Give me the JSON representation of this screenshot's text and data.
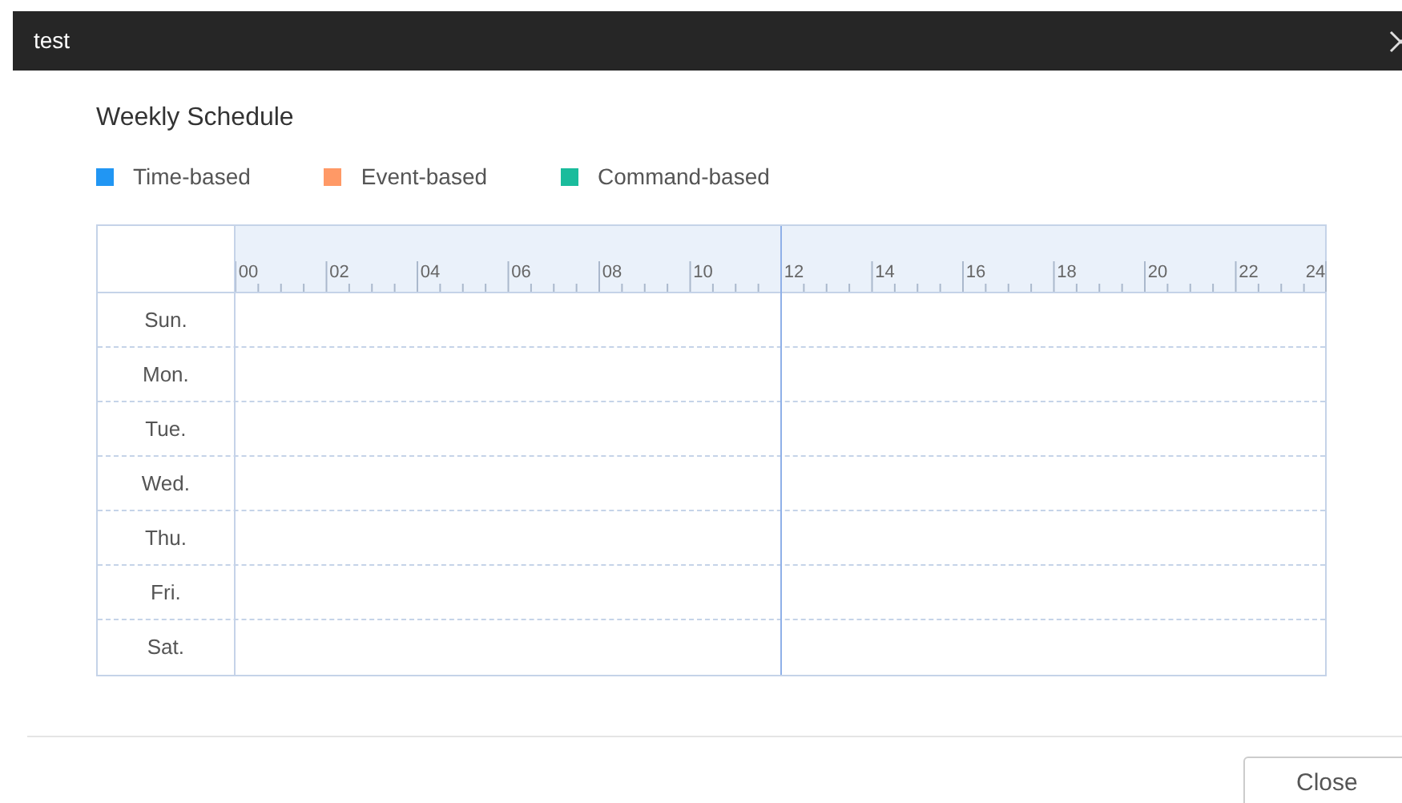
{
  "window": {
    "title": "test"
  },
  "heading": "Weekly Schedule",
  "legend": [
    {
      "label": "Time-based",
      "color": "#2196f3"
    },
    {
      "label": "Event-based",
      "color": "#ff9966"
    },
    {
      "label": "Command-based",
      "color": "#1abc9c"
    }
  ],
  "schedule": {
    "hours": [
      "00",
      "02",
      "04",
      "06",
      "08",
      "10",
      "12",
      "14",
      "16",
      "18",
      "20",
      "22",
      "24"
    ],
    "days": [
      "Sun.",
      "Mon.",
      "Tue.",
      "Wed.",
      "Thu.",
      "Fri.",
      "Sat."
    ]
  },
  "buttons": [
    "Close"
  ]
}
